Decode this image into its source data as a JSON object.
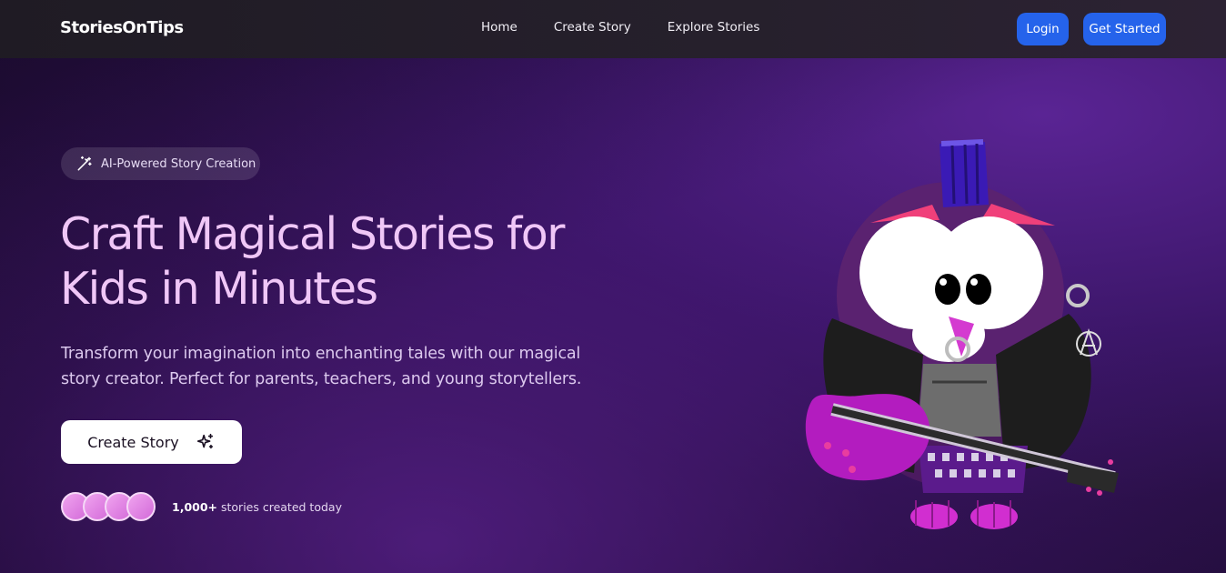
{
  "nav": {
    "brand": "StoriesOnTips",
    "links": [
      "Home",
      "Create Story",
      "Explore Stories"
    ],
    "login_label": "Login",
    "get_started_label": "Get Started"
  },
  "hero": {
    "badge_text": "AI-Powered Story Creation",
    "headline_line1": "Craft Magical Stories for",
    "headline_line2": "Kids in Minutes",
    "subtitle_line1": "Transform your imagination into enchanting tales with our magical",
    "subtitle_line2": "story creator. Perfect for parents, teachers, and young storytellers.",
    "cta_label": "Create Story",
    "social_count": "1,000+",
    "social_text": " stories created today"
  },
  "icons": {
    "badge": "magic-wand-icon",
    "cta": "sparkles-icon"
  },
  "colors": {
    "accent_blue": "#2563eb",
    "headline_pink": "#f0c7f7"
  }
}
